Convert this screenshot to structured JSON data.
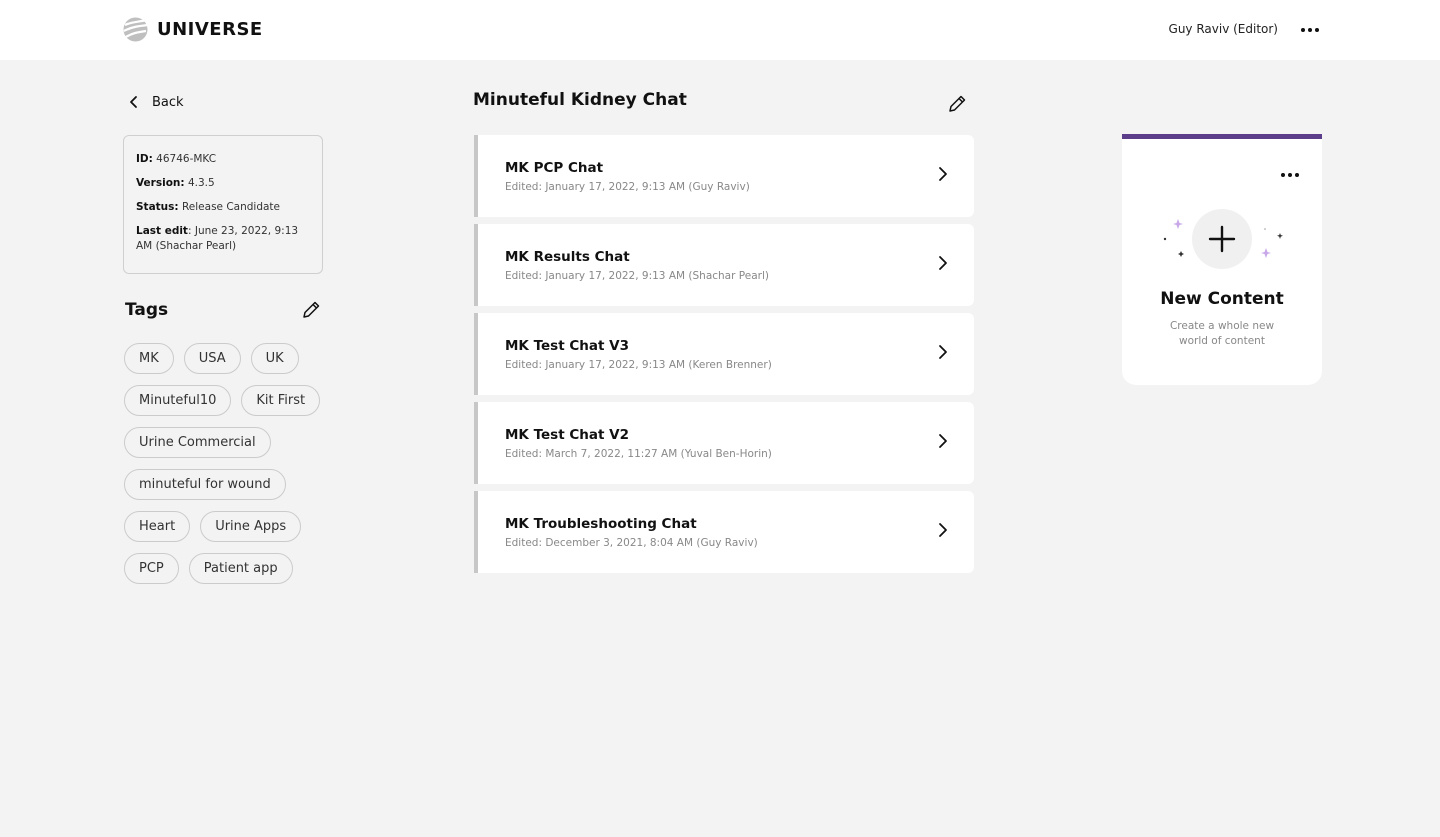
{
  "app": {
    "name": "UNIVERSE"
  },
  "header": {
    "user": "Guy Raviv (Editor)"
  },
  "sidebar": {
    "back_label": "Back",
    "info": {
      "id_label": "ID:",
      "id_value": "46746-MKC",
      "version_label": "Version:",
      "version_value": "4.3.5",
      "status_label": "Status:",
      "status_value": "Release Candidate",
      "last_edit_label": "Last edit",
      "last_edit_value": ": June 23, 2022, 9:13 AM (Shachar Pearl)"
    },
    "tags_title": "Tags",
    "tag_rows": [
      [
        "MK",
        "USA",
        "UK"
      ],
      [
        "Minuteful10",
        "Kit First"
      ],
      [
        "Urine Commercial"
      ],
      [
        "minuteful for wound"
      ],
      [
        "Heart",
        "Urine Apps"
      ],
      [
        "PCP",
        "Patient app"
      ]
    ]
  },
  "main": {
    "title": "Minuteful Kidney Chat",
    "items": [
      {
        "title": "MK PCP Chat",
        "meta": "Edited: January 17, 2022, 9:13 AM (Guy Raviv)"
      },
      {
        "title": "MK Results Chat",
        "meta": "Edited: January 17, 2022, 9:13 AM (Shachar Pearl)"
      },
      {
        "title": "MK Test Chat V3",
        "meta": "Edited: January 17, 2022, 9:13 AM (Keren Brenner)"
      },
      {
        "title": "MK Test Chat V2",
        "meta": "Edited: March 7, 2022, 11:27 AM (Yuval Ben-Horin)"
      },
      {
        "title": "MK Troubleshooting Chat",
        "meta": "Edited: December 3, 2021, 8:04 AM (Guy Raviv)"
      }
    ]
  },
  "new_content": {
    "title": "New Content",
    "description": "Create a whole new world of content"
  },
  "icons": {
    "logo": "universe-logo-icon",
    "more": "more-horizontal-icon",
    "back": "chevron-left-icon",
    "edit": "pencil-icon",
    "chevron": "chevron-right-icon",
    "plus": "plus-icon"
  },
  "colors": {
    "accent": "#5b3d8a",
    "background": "#f3f3f3",
    "sparkle": "#c9a8e8"
  }
}
